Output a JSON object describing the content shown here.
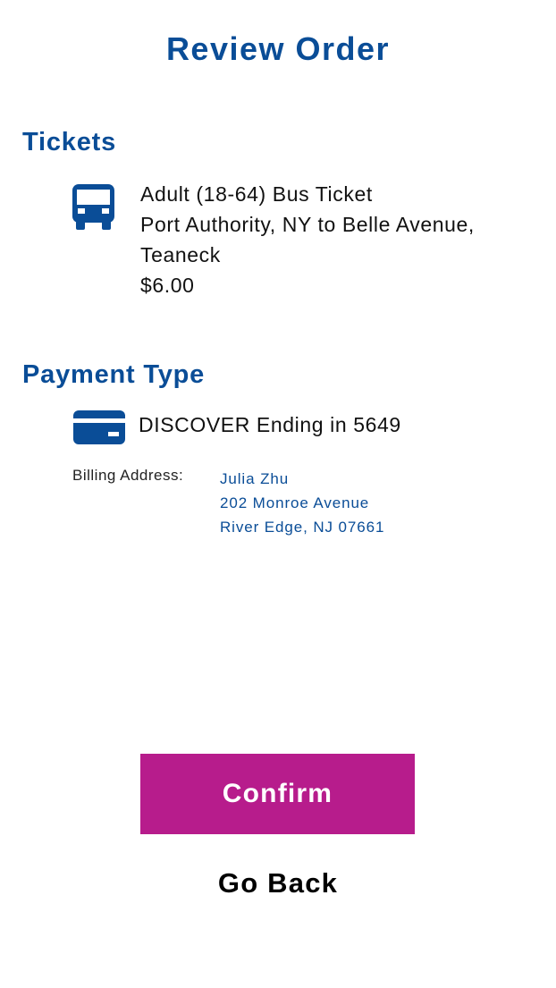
{
  "header": {
    "title": "Review Order"
  },
  "tickets": {
    "section_title": "Tickets",
    "icon": "bus-icon",
    "items": [
      {
        "type": "Adult (18-64) Bus Ticket",
        "route_line1": "Port Authority, NY to Belle Avenue,",
        "route_line2": "Teaneck",
        "price": "$6.00"
      }
    ]
  },
  "payment": {
    "section_title": "Payment Type",
    "icon": "credit-card-icon",
    "card_text": "DISCOVER Ending in 5649",
    "billing_label": "Billing Address:",
    "billing_address": {
      "name": "Julia Zhu",
      "street": "202 Monroe Avenue",
      "city_state_zip": "River Edge, NJ 07661"
    }
  },
  "actions": {
    "confirm_label": "Confirm",
    "go_back_label": "Go Back"
  },
  "colors": {
    "accent_blue": "#0a4d97",
    "confirm_magenta": "#b71c8c",
    "background": "#ffffff"
  }
}
